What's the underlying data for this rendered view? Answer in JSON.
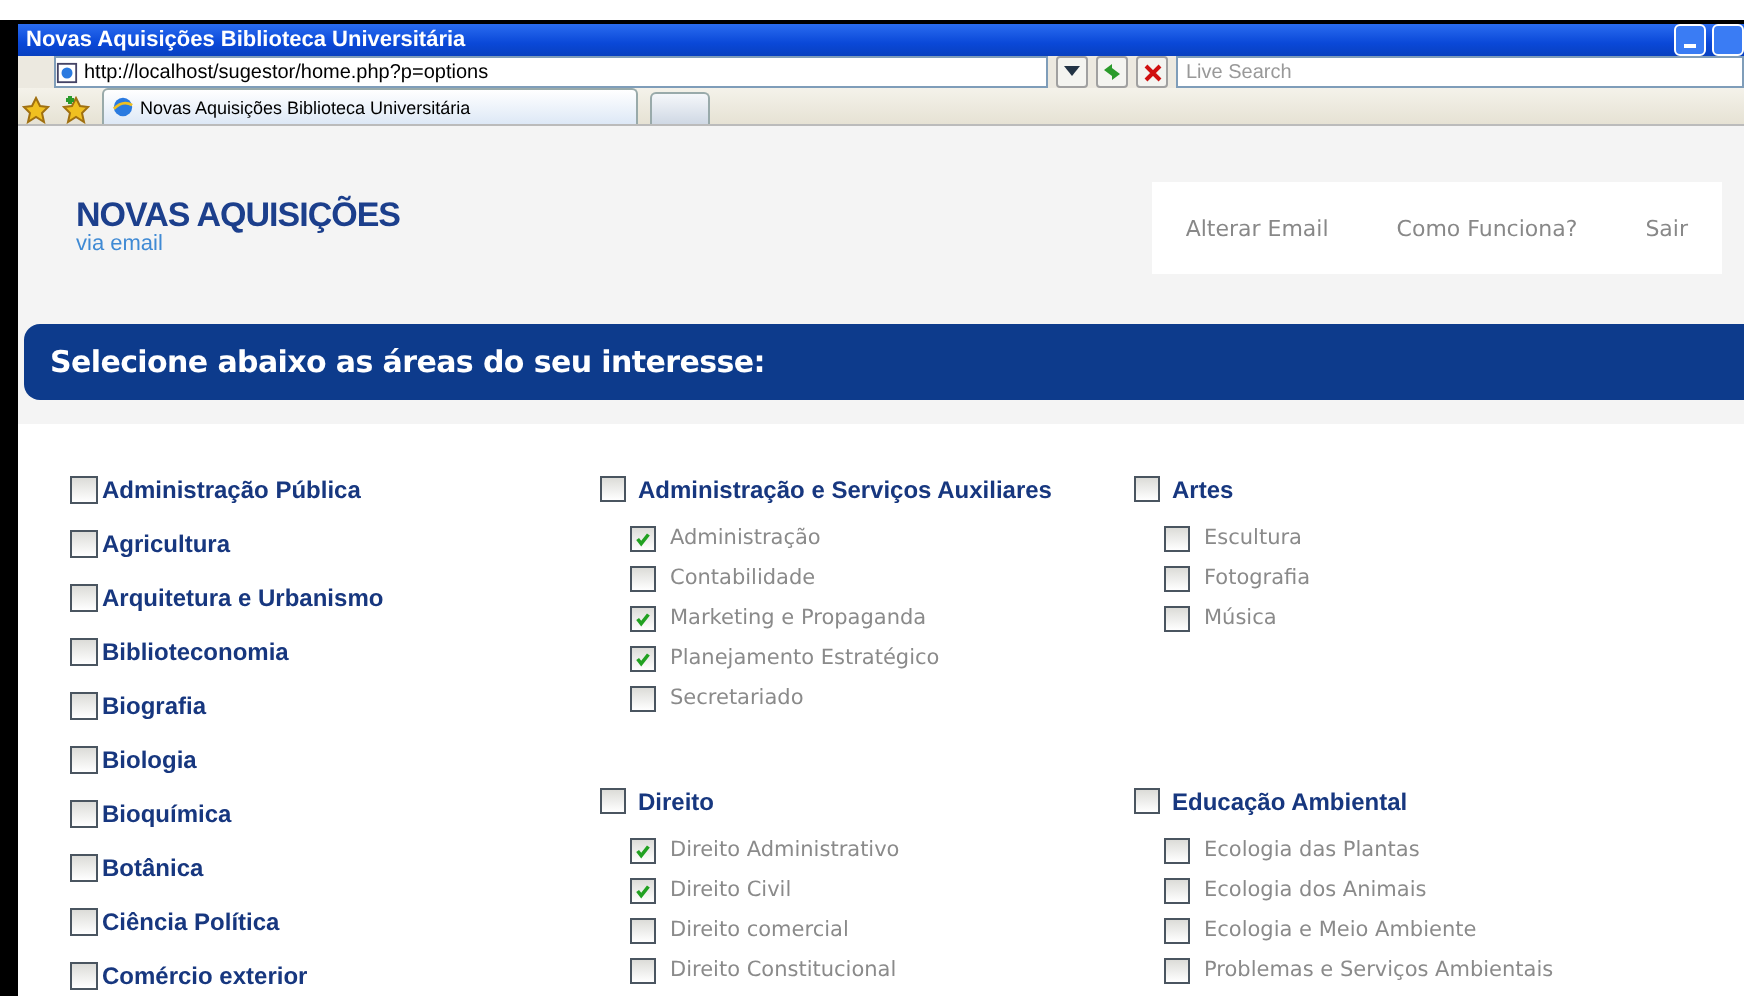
{
  "window": {
    "title": "Novas Aquisições Biblioteca Universitária"
  },
  "browser": {
    "url": "http://localhost/sugestor/home.php?p=options",
    "search_placeholder": "Live Search",
    "tabs": [
      {
        "label": "Novas Aquisições Biblioteca Universitária",
        "selected": true
      }
    ]
  },
  "brand": {
    "title": "NOVAS AQUISIÇÕES",
    "subtitle": "via email"
  },
  "nav": [
    "Alterar Email",
    "Como Funciona?",
    "Sair"
  ],
  "banner": "Selecione abaixo as áreas do seu interesse:",
  "areas": [
    {
      "label": "Administração Pública",
      "checked": false
    },
    {
      "label": "Agricultura",
      "checked": false
    },
    {
      "label": "Arquitetura e Urbanismo",
      "checked": false
    },
    {
      "label": "Biblioteconomia",
      "checked": false
    },
    {
      "label": "Biografia",
      "checked": false
    },
    {
      "label": "Biologia",
      "checked": false
    },
    {
      "label": "Bioquímica",
      "checked": false
    },
    {
      "label": "Botânica",
      "checked": false
    },
    {
      "label": "Ciência Política",
      "checked": false
    },
    {
      "label": "Comércio exterior",
      "checked": false
    }
  ],
  "group_columns": [
    {
      "groups": [
        {
          "label": "Administração e Serviços Auxiliares",
          "checked": false,
          "children": [
            {
              "label": "Administração",
              "checked": true
            },
            {
              "label": "Contabilidade",
              "checked": false
            },
            {
              "label": "Marketing e Propaganda",
              "checked": true
            },
            {
              "label": "Planejamento Estratégico",
              "checked": true
            },
            {
              "label": "Secretariado",
              "checked": false
            }
          ]
        },
        {
          "label": "Direito",
          "checked": false,
          "children": [
            {
              "label": "Direito Administrativo",
              "checked": true
            },
            {
              "label": "Direito Civil",
              "checked": true
            },
            {
              "label": "Direito comercial",
              "checked": false
            },
            {
              "label": "Direito Constitucional",
              "checked": false
            }
          ]
        }
      ]
    },
    {
      "groups": [
        {
          "label": "Artes",
          "checked": false,
          "children": [
            {
              "label": "Escultura",
              "checked": false
            },
            {
              "label": "Fotografia",
              "checked": false
            },
            {
              "label": "Música",
              "checked": false
            }
          ]
        },
        {
          "label": "Educação Ambiental",
          "checked": false,
          "children": [
            {
              "label": "Ecologia das Plantas",
              "checked": false
            },
            {
              "label": "Ecologia dos Animais",
              "checked": false
            },
            {
              "label": "Ecologia e Meio Ambiente",
              "checked": false
            },
            {
              "label": "Problemas e Serviços Ambientais",
              "checked": false
            }
          ]
        }
      ]
    }
  ]
}
